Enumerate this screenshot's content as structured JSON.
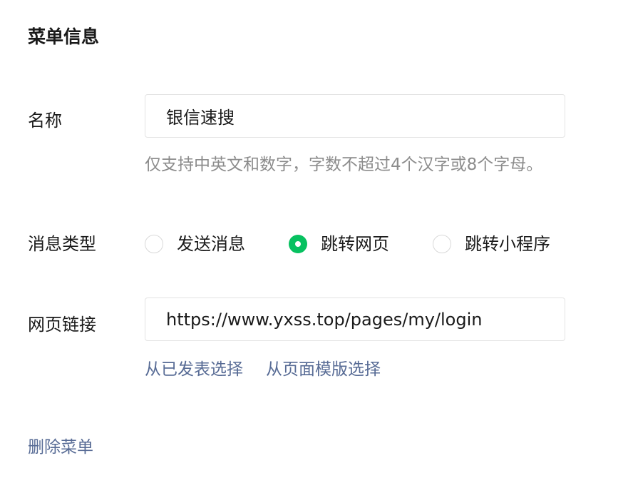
{
  "colors": {
    "accent_green": "#07c160",
    "link_blue": "#576b95",
    "hint_gray": "#8c8c8c",
    "border_gray": "#e3e3e3"
  },
  "panel": {
    "title": "菜单信息"
  },
  "name_field": {
    "label": "名称",
    "value": "银信速搜",
    "hint": "仅支持中英文和数字，字数不超过4个汉字或8个字母。"
  },
  "message_type": {
    "label": "消息类型",
    "selected": "跳转网页",
    "options": [
      {
        "label": "发送消息",
        "checked": false
      },
      {
        "label": "跳转网页",
        "checked": true
      },
      {
        "label": "跳转小程序",
        "checked": false
      }
    ]
  },
  "url_field": {
    "label": "网页链接",
    "value": "https://www.yxss.top/pages/my/login",
    "links": {
      "from_published": "从已发表选择",
      "from_template": "从页面模版选择"
    }
  },
  "delete_menu": "删除菜单"
}
